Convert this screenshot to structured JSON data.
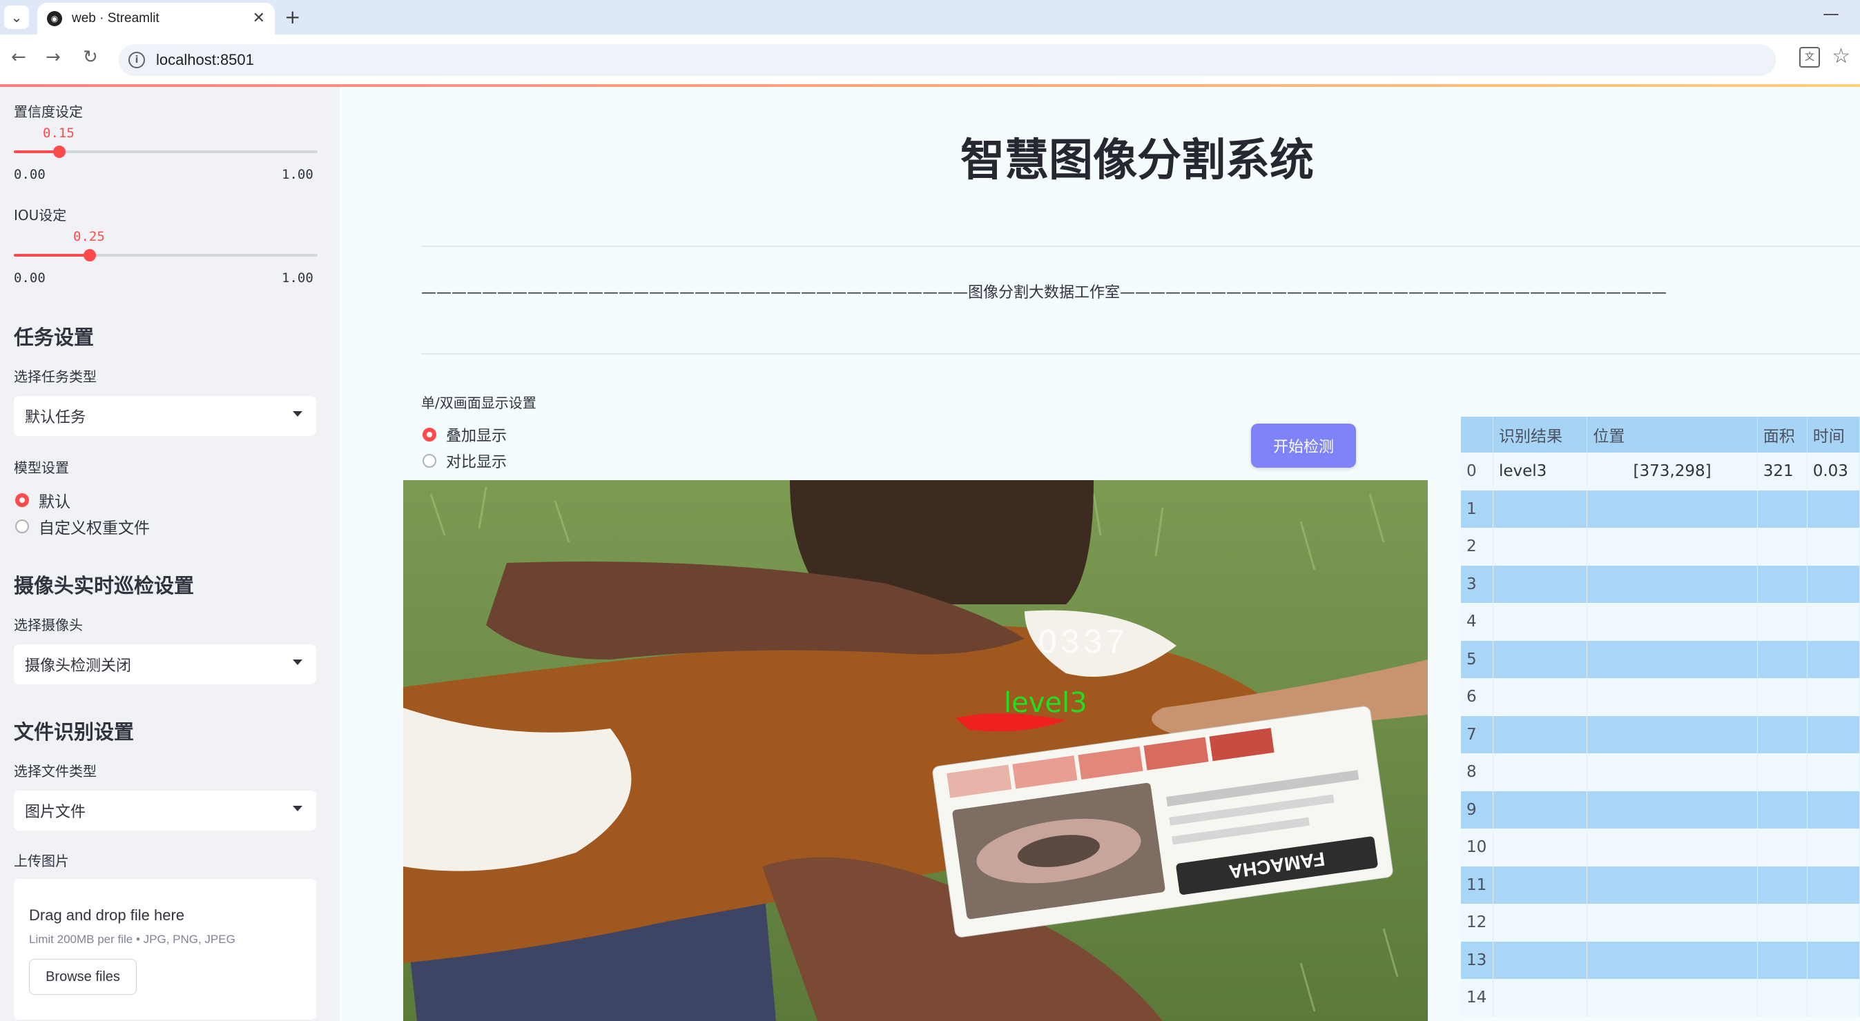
{
  "browser": {
    "tab_title": "web · Streamlit",
    "url": "localhost:8501"
  },
  "sidebar": {
    "confidence": {
      "label": "置信度设定",
      "value": 0.15,
      "value_text": "0.15",
      "min_text": "0.00",
      "max_text": "1.00"
    },
    "iou": {
      "label": "IOU设定",
      "value": 0.25,
      "value_text": "0.25",
      "min_text": "0.00",
      "max_text": "1.00"
    },
    "task": {
      "heading": "任务设置",
      "select_label": "选择任务类型",
      "selected": "默认任务"
    },
    "model": {
      "label": "模型设置",
      "options": [
        {
          "label": "默认",
          "checked": true
        },
        {
          "label": "自定义权重文件",
          "checked": false
        }
      ]
    },
    "camera": {
      "heading": "摄像头实时巡检设置",
      "select_label": "选择摄像头",
      "selected": "摄像头检测关闭"
    },
    "file": {
      "heading": "文件识别设置",
      "select_label": "选择文件类型",
      "selected": "图片文件"
    },
    "upload": {
      "label": "上传图片",
      "drop_text": "Drag and drop file here",
      "limit_text": "Limit 200MB per file • JPG, PNG, JPEG",
      "browse_label": "Browse files"
    }
  },
  "main": {
    "title": "智慧图像分割系统",
    "banner": "————————————————————————————————————图像分割大数据工作室————————————————————————————————————",
    "display_label": "单/双画面显示设置",
    "display_options": [
      {
        "label": "叠加显示",
        "checked": true
      },
      {
        "label": "对比显示",
        "checked": false
      }
    ],
    "start_button": "开始检测",
    "image": {
      "detection_label": "level3",
      "card_brand": "FAMACHA",
      "tag_number": "0337"
    }
  },
  "results_table": {
    "columns": [
      "",
      "识别结果",
      "位置",
      "面积",
      "时间"
    ],
    "rows": [
      {
        "index": "0",
        "result": "level3",
        "position": "[373,298]",
        "area": "321",
        "time": "0.03"
      },
      {
        "index": "1",
        "result": "",
        "position": "",
        "area": "",
        "time": ""
      },
      {
        "index": "2",
        "result": "",
        "position": "",
        "area": "",
        "time": ""
      },
      {
        "index": "3",
        "result": "",
        "position": "",
        "area": "",
        "time": ""
      },
      {
        "index": "4",
        "result": "",
        "position": "",
        "area": "",
        "time": ""
      },
      {
        "index": "5",
        "result": "",
        "position": "",
        "area": "",
        "time": ""
      },
      {
        "index": "6",
        "result": "",
        "position": "",
        "area": "",
        "time": ""
      },
      {
        "index": "7",
        "result": "",
        "position": "",
        "area": "",
        "time": ""
      },
      {
        "index": "8",
        "result": "",
        "position": "",
        "area": "",
        "time": ""
      },
      {
        "index": "9",
        "result": "",
        "position": "",
        "area": "",
        "time": ""
      },
      {
        "index": "10",
        "result": "",
        "position": "",
        "area": "",
        "time": ""
      },
      {
        "index": "11",
        "result": "",
        "position": "",
        "area": "",
        "time": ""
      },
      {
        "index": "12",
        "result": "",
        "position": "",
        "area": "",
        "time": ""
      },
      {
        "index": "13",
        "result": "",
        "position": "",
        "area": "",
        "time": ""
      },
      {
        "index": "14",
        "result": "",
        "position": "",
        "area": "",
        "time": ""
      }
    ]
  },
  "colors": {
    "accent": "#ff4b4b",
    "sidebar_bg": "#f0f2f6",
    "button": "#7e83f7",
    "table_header": "#a7d4f5",
    "detection_label": "#22dd22"
  }
}
